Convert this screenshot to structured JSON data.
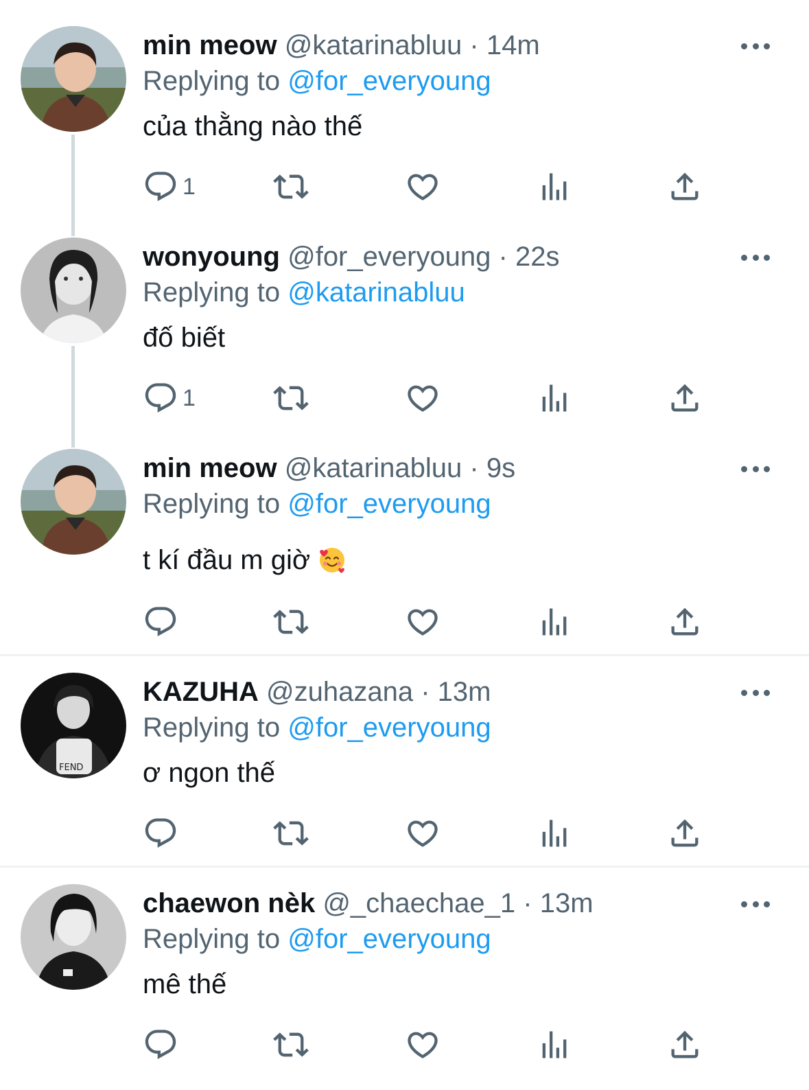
{
  "tweets": [
    {
      "name": "min meow",
      "handle": "@katarinabluu",
      "dot": "·",
      "time": "14m",
      "reply_prefix": "Replying to",
      "reply_to": "@for_everyoung",
      "text": "của thằng nào thế",
      "reply_count": "1"
    },
    {
      "name": "wonyoung",
      "handle": "@for_everyoung",
      "dot": "·",
      "time": "22s",
      "reply_prefix": "Replying to",
      "reply_to": "@katarinabluu",
      "text": "đố biết",
      "reply_count": "1"
    },
    {
      "name": "min meow",
      "handle": "@katarinabluu",
      "dot": "·",
      "time": "9s",
      "reply_prefix": "Replying to",
      "reply_to": "@for_everyoung",
      "text": "t kí đầu m giờ",
      "emoji": "smiling-face-with-hearts",
      "reply_count": ""
    },
    {
      "name": "KAZUHA",
      "handle": "@zuhazana",
      "dot": "·",
      "time": "13m",
      "reply_prefix": "Replying to",
      "reply_to": "@for_everyoung",
      "text": "ơ ngon thế",
      "reply_count": ""
    },
    {
      "name": "chaewon nèk",
      "handle": "@_chaechae_1",
      "dot": "·",
      "time": "13m",
      "reply_prefix": "Replying to",
      "reply_to": "@for_everyoung",
      "text": "mê thế",
      "reply_count": ""
    }
  ],
  "colors": {
    "accent": "#1d9bf0",
    "secondary_text": "#536471",
    "thread_line": "#cfd9de",
    "divider": "#eff3f4"
  },
  "icons": [
    "reply-icon",
    "retweet-icon",
    "like-icon",
    "views-icon",
    "share-icon",
    "more-icon"
  ]
}
